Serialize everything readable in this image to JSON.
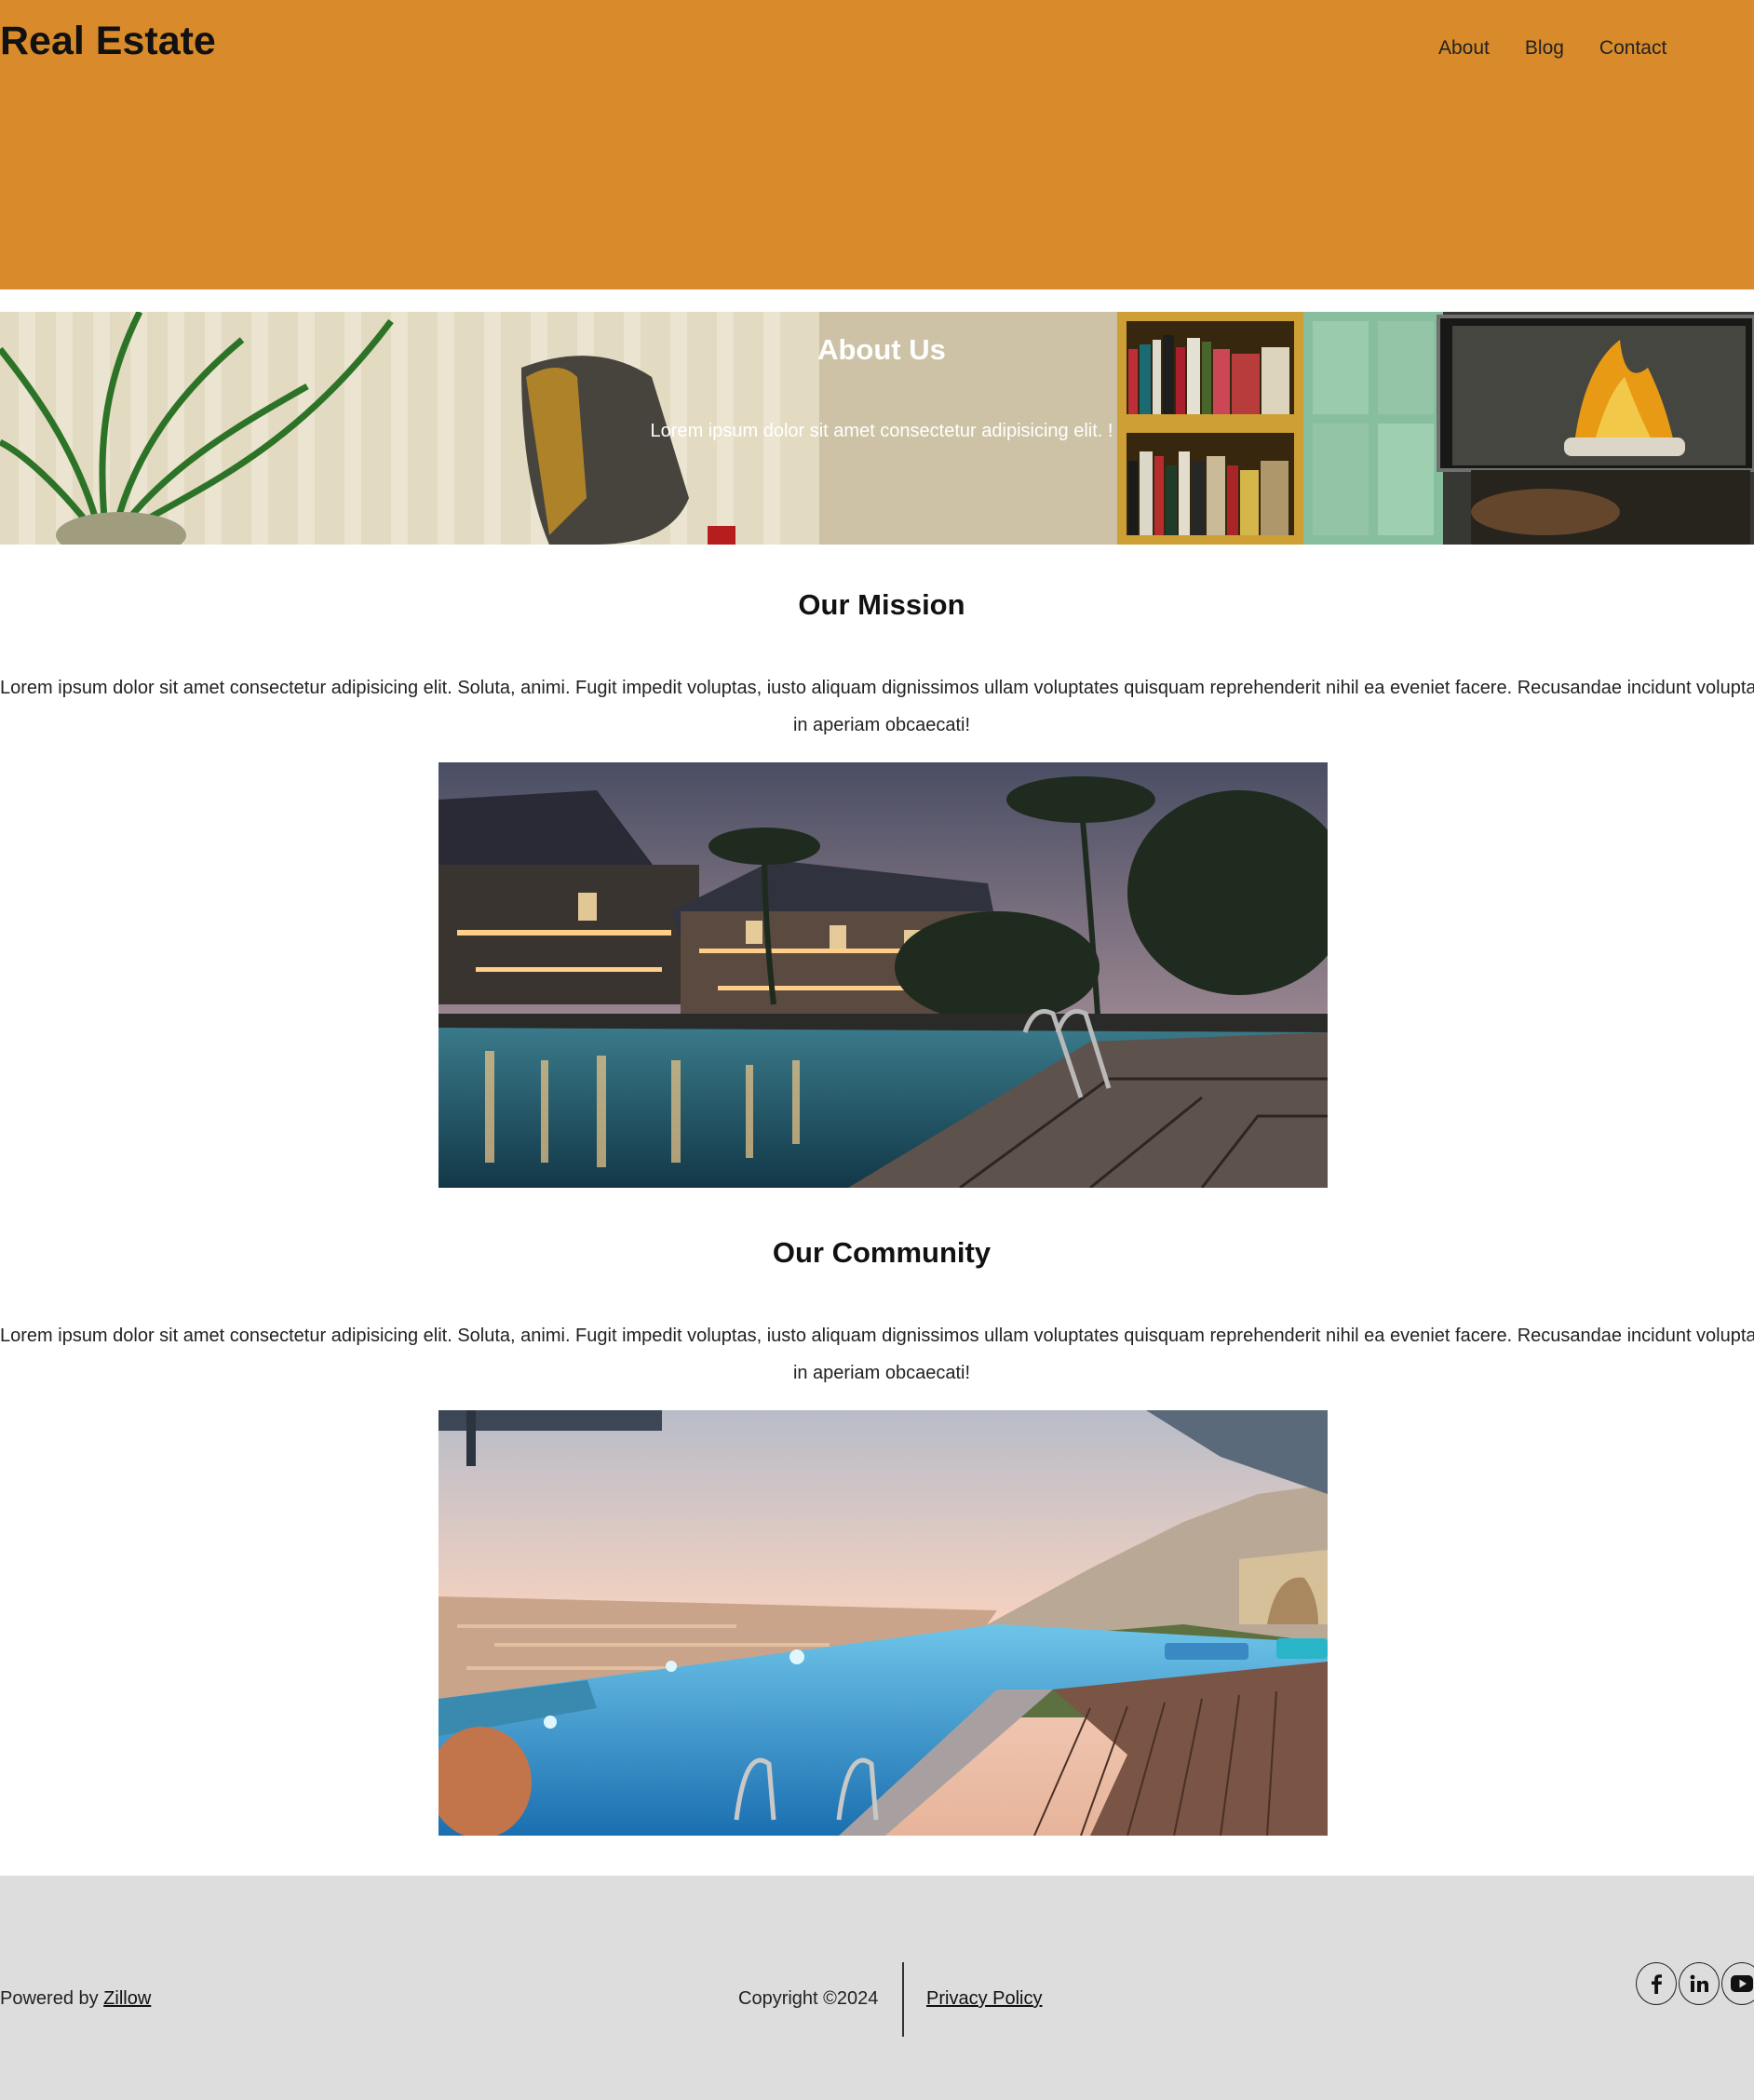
{
  "header": {
    "logo": "Real Estate",
    "nav": [
      "About",
      "Blog",
      "Contact"
    ],
    "background_color": "#d98b2b"
  },
  "hero": {
    "title": "About Us",
    "subtitle": "Lorem ipsum dolor sit amet consectetur adipisicing elit. !"
  },
  "mission": {
    "title": "Our Mission",
    "text_line1": "Lorem ipsum dolor sit amet consectetur adipisicing elit. Soluta, animi. Fugit impedit voluptas, iusto aliquam dignissimos ullam voluptates quisquam reprehenderit nihil ea eveniet facere. Recusandae incidunt voluptatem",
    "text_line2": "in aperiam obcaecati!"
  },
  "community": {
    "title": "Our Community",
    "text_line1": "Lorem ipsum dolor sit amet consectetur adipisicing elit. Soluta, animi. Fugit impedit voluptas, iusto aliquam dignissimos ullam voluptates quisquam reprehenderit nihil ea eveniet facere. Recusandae incidunt voluptatem",
    "text_line2": "in aperiam obcaecati!"
  },
  "footer": {
    "powered_prefix": "Powered by ",
    "powered_link": "Zillow",
    "copyright": "Copyright ©2024",
    "privacy": "Privacy Policy",
    "social_icons": [
      "facebook-icon",
      "linkedin-icon",
      "youtube-icon"
    ],
    "background_color": "#dddddd"
  }
}
